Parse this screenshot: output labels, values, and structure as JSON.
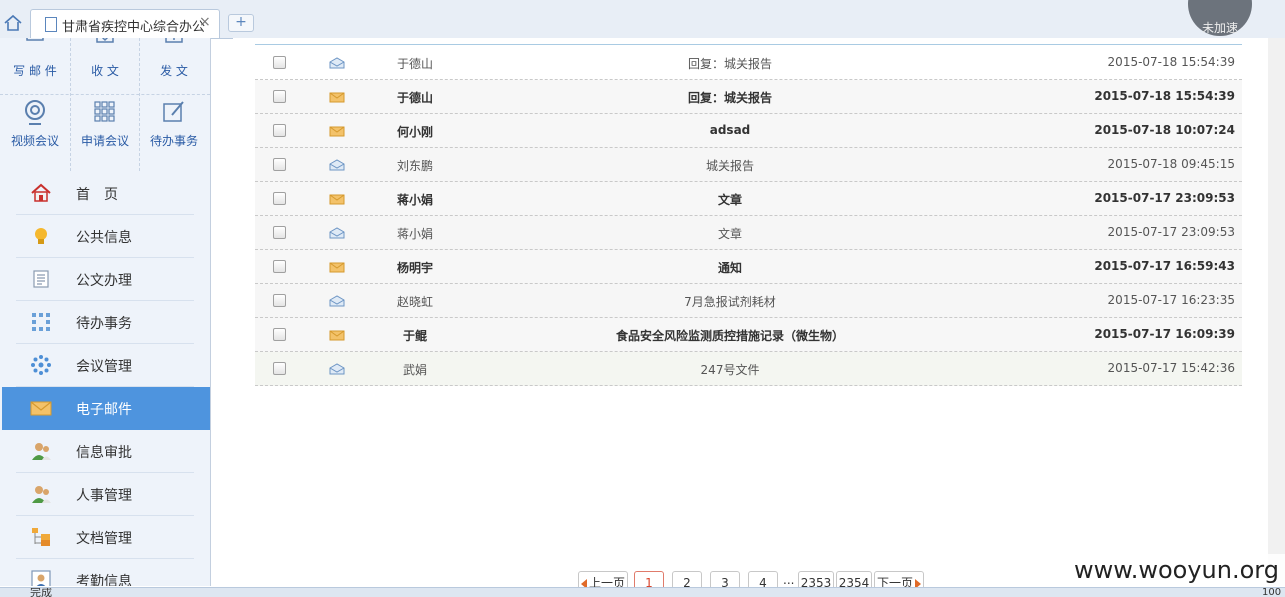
{
  "browser": {
    "tab_title": "甘肃省疾控中心综合办公",
    "close_glyph": "×",
    "new_tab_glyph": "+",
    "speed_badge": "未加速",
    "status_text": "完成",
    "zoom_text": "100"
  },
  "sidebar": {
    "quick_actions": [
      {
        "label": "写 邮 件",
        "icon": "compose-icon"
      },
      {
        "label": "收 文",
        "icon": "inbox-icon"
      },
      {
        "label": "发 文",
        "icon": "send-doc-icon"
      },
      {
        "label": "视频会议",
        "icon": "webcam-icon"
      },
      {
        "label": "申请会议",
        "icon": "grid-icon"
      },
      {
        "label": "待办事务",
        "icon": "edit-icon"
      }
    ],
    "nav": [
      {
        "label": "首　页",
        "icon": "home-icon"
      },
      {
        "label": "公共信息",
        "icon": "lightbulb-icon"
      },
      {
        "label": "公文办理",
        "icon": "document-list-icon"
      },
      {
        "label": "待办事务",
        "icon": "dots-grid-icon"
      },
      {
        "label": "会议管理",
        "icon": "snowflake-icon"
      },
      {
        "label": "电子邮件",
        "icon": "envelope-icon",
        "active": true
      },
      {
        "label": "信息审批",
        "icon": "users-icon"
      },
      {
        "label": "人事管理",
        "icon": "users-icon"
      },
      {
        "label": "文档管理",
        "icon": "folders-icon"
      },
      {
        "label": "考勤信息",
        "icon": "id-card-icon"
      }
    ]
  },
  "mail": {
    "rows": [
      {
        "sender": "于德山",
        "subject": "回复：城关报告",
        "time": "2015-07-18 15:54:39",
        "read": true
      },
      {
        "sender": "于德山",
        "subject": "回复：城关报告",
        "time": "2015-07-18 15:54:39",
        "read": false
      },
      {
        "sender": "何小刚",
        "subject": "adsad",
        "time": "2015-07-18 10:07:24",
        "read": false
      },
      {
        "sender": "刘东鹏",
        "subject": "城关报告",
        "time": "2015-07-18 09:45:15",
        "read": true
      },
      {
        "sender": "蒋小娟",
        "subject": "文章",
        "time": "2015-07-17 23:09:53",
        "read": false
      },
      {
        "sender": "蒋小娟",
        "subject": "文章",
        "time": "2015-07-17 23:09:53",
        "read": true
      },
      {
        "sender": "杨明宇",
        "subject": "通知",
        "time": "2015-07-17 16:59:43",
        "read": false
      },
      {
        "sender": "赵晓虹",
        "subject": "7月急报试剂耗材",
        "time": "2015-07-17 16:23:35",
        "read": true
      },
      {
        "sender": "于鲲",
        "subject": "食品安全风险监测质控措施记录（微生物）",
        "time": "2015-07-17 16:09:39",
        "read": false
      },
      {
        "sender": "武娟",
        "subject": "247号文件",
        "time": "2015-07-17 15:42:36",
        "read": true
      }
    ]
  },
  "pager": {
    "prev": "上一页",
    "pages": [
      "1",
      "2",
      "3",
      "4"
    ],
    "ellipsis": "...",
    "tail_pages": [
      "2353",
      "2354"
    ],
    "next": "下一页",
    "current": "1"
  },
  "watermark": "www.wooyun.org"
}
